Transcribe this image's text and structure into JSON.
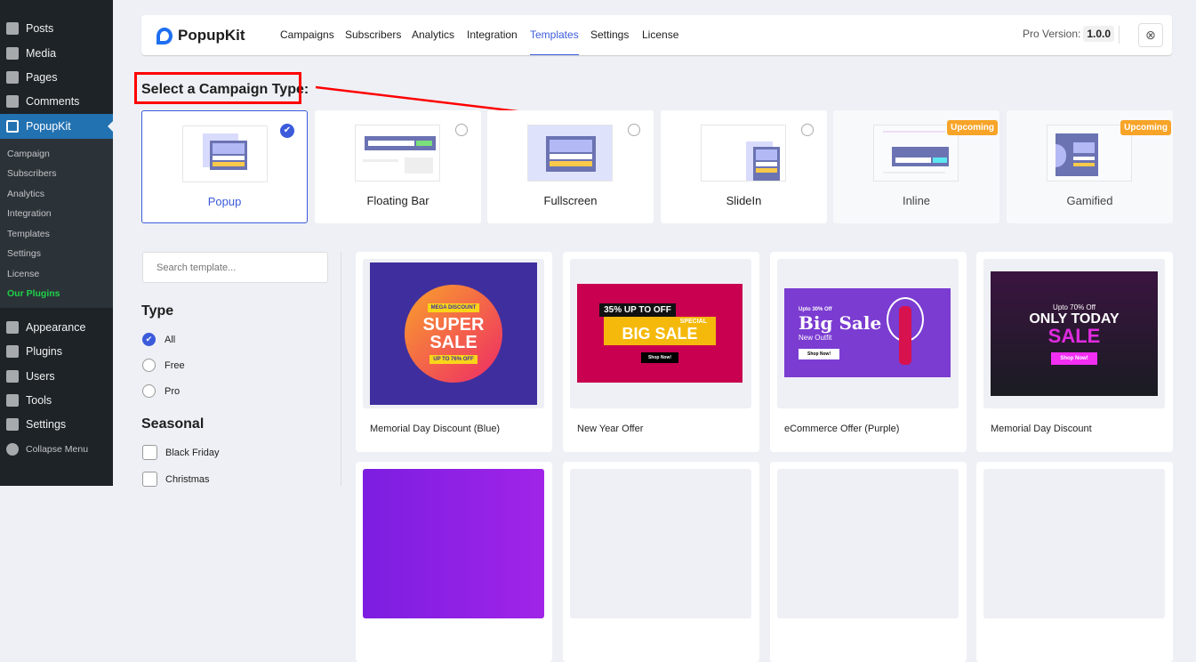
{
  "sidebar": {
    "items": [
      "Posts",
      "Media",
      "Pages",
      "Comments",
      "PopupKit",
      "Appearance",
      "Plugins",
      "Users",
      "Tools",
      "Settings",
      "Collapse Menu"
    ],
    "submenu": [
      "Campaign",
      "Subscribers",
      "Analytics",
      "Integration",
      "Templates",
      "Settings",
      "License",
      "Our Plugins"
    ]
  },
  "header": {
    "logo": "PopupKit",
    "nav": [
      "Campaigns",
      "Subscribers",
      "Analytics",
      "Integration",
      "Templates",
      "Settings",
      "License"
    ],
    "active": "Templates",
    "pro_label": "Pro Version:",
    "version": "1.0.0"
  },
  "campaign_type": {
    "title": "Select a Campaign Type:",
    "types": [
      {
        "label": "Popup",
        "selected": true
      },
      {
        "label": "Floating Bar"
      },
      {
        "label": "Fullscreen"
      },
      {
        "label": "SlideIn"
      },
      {
        "label": "Inline",
        "badge": "Upcoming"
      },
      {
        "label": "Gamified",
        "badge": "Upcoming"
      }
    ]
  },
  "filters": {
    "search_placeholder": "Search template...",
    "type_title": "Type",
    "type_options": [
      "All",
      "Free",
      "Pro"
    ],
    "seasonal_title": "Seasonal",
    "seasonal_options": [
      "Black Friday",
      "Christmas"
    ]
  },
  "templates": [
    {
      "name": "Memorial Day Discount (Blue)",
      "art": [
        "MEGA DISCOUNT",
        "SUPER SALE",
        "UP TO 76% OFF"
      ]
    },
    {
      "name": "New Year Offer",
      "art": [
        "35% UP TO OFF",
        "SPECIAL",
        "BIG SALE",
        "Shop Now!"
      ]
    },
    {
      "name": "eCommerce Offer (Purple)",
      "art": [
        "Upto 30% Off",
        "Big Sale",
        "New Outfit",
        "Shop Now!"
      ]
    },
    {
      "name": "Memorial Day Discount",
      "art": [
        "Upto 70% Off",
        "ONLY TODAY",
        "SALE",
        "Shop Now!"
      ]
    }
  ],
  "colors": {
    "accent": "#3b5bdb",
    "wp_sidebar": "#1d2327",
    "wp_active": "#2271b1",
    "badge": "#f7a428",
    "annotation": "#ff0000"
  }
}
